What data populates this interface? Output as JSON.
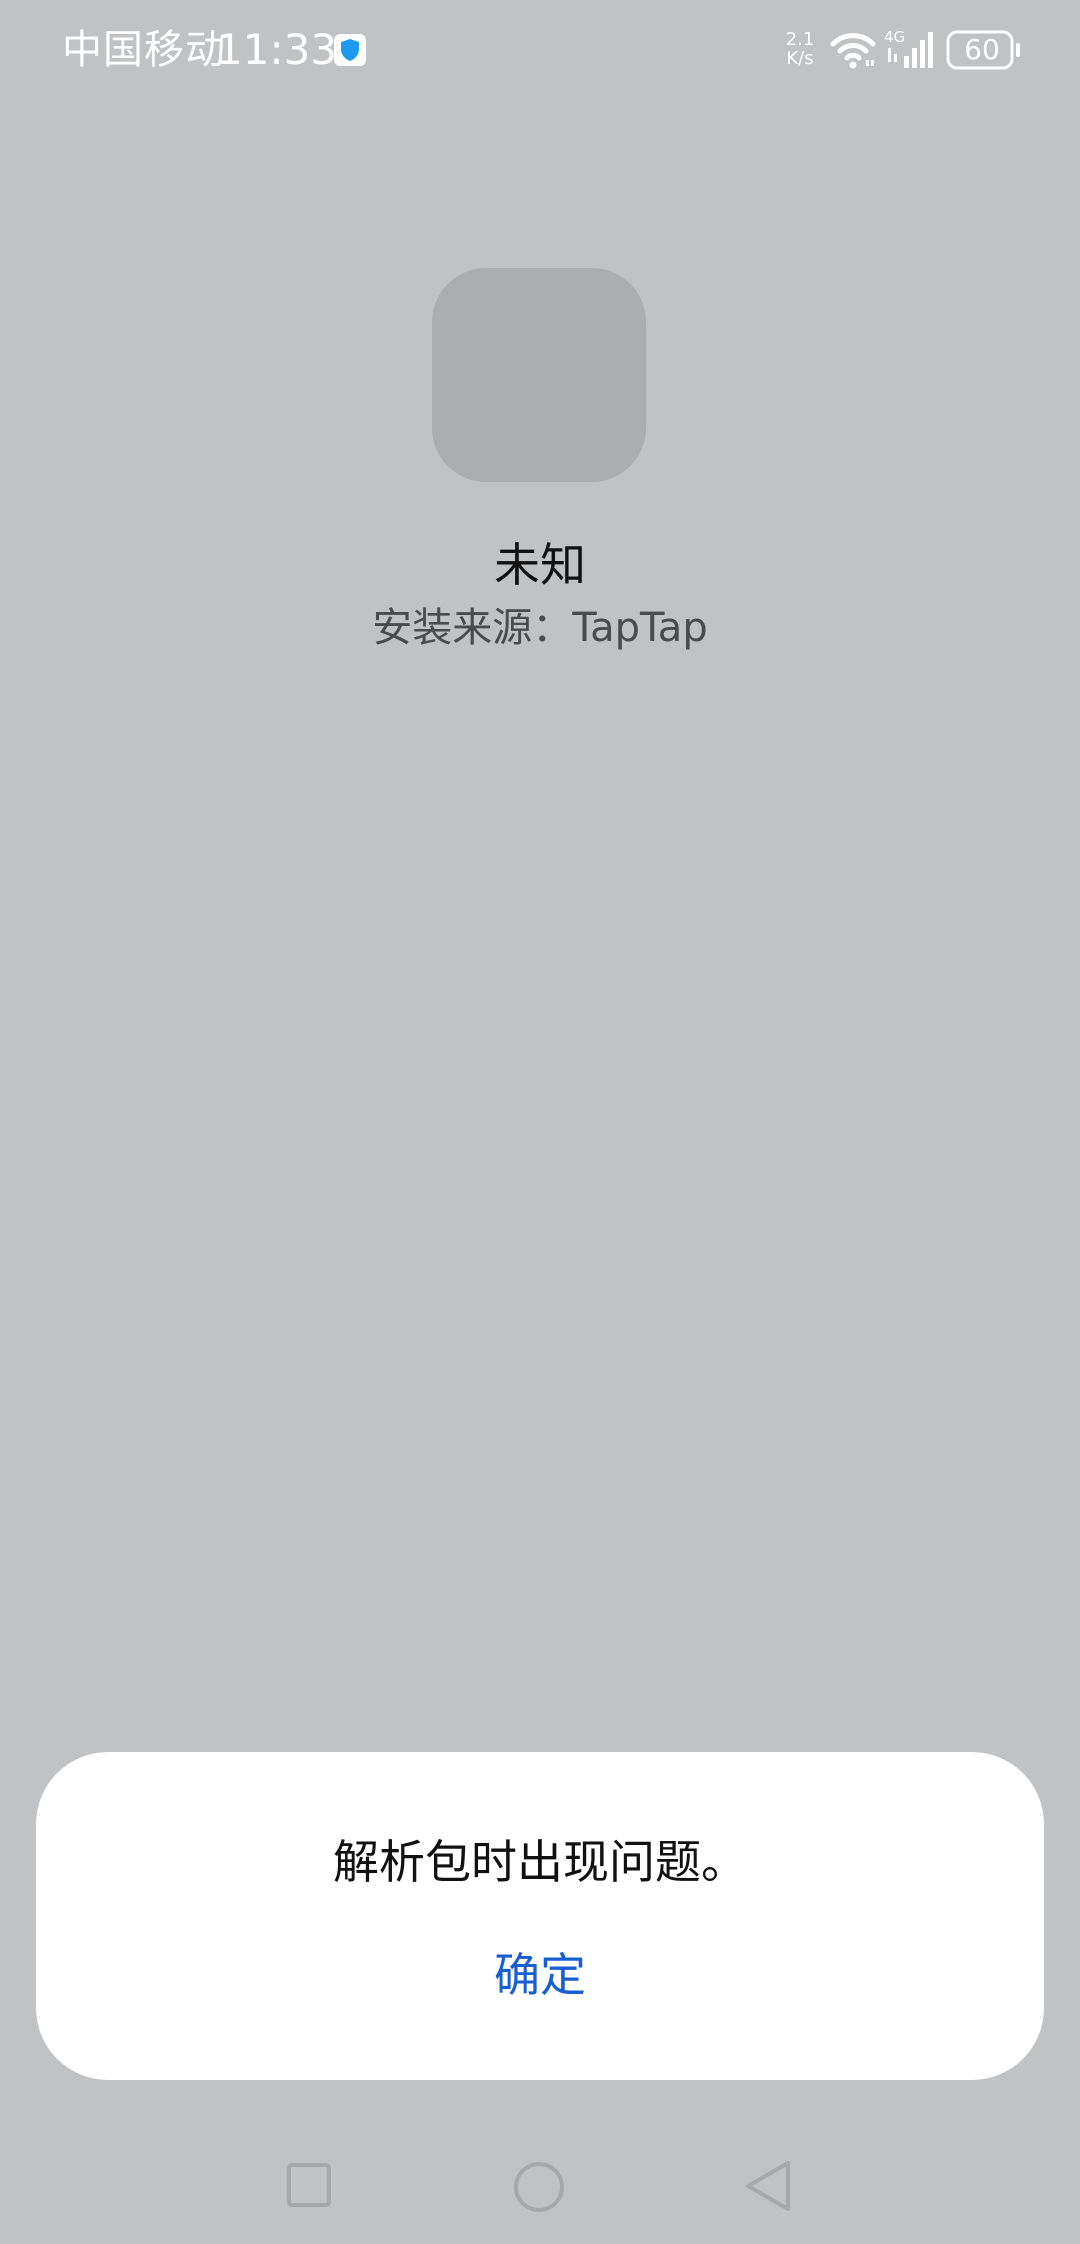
{
  "status_bar": {
    "carrier": "中国移动",
    "time": "11:33",
    "net_speed_value": "2.1",
    "net_speed_unit": "K/s",
    "network_type": "4G",
    "battery": "60",
    "icons": [
      "shield-icon",
      "wifi-icon",
      "signal-icon",
      "battery-icon"
    ]
  },
  "app": {
    "name": "未知",
    "install_source": "安装来源：TapTap",
    "icon": "app-placeholder-icon"
  },
  "dialog": {
    "message": "解析包时出现问题。",
    "confirm_label": "确定"
  },
  "nav_bar": {
    "icons": [
      "recent-apps-icon",
      "home-icon",
      "back-icon"
    ]
  },
  "colors": {
    "background": "#c1c2c4",
    "dialog_background": "#ffffff",
    "accent": "#1a5fd1",
    "icon_placeholder": "#acadaf"
  }
}
